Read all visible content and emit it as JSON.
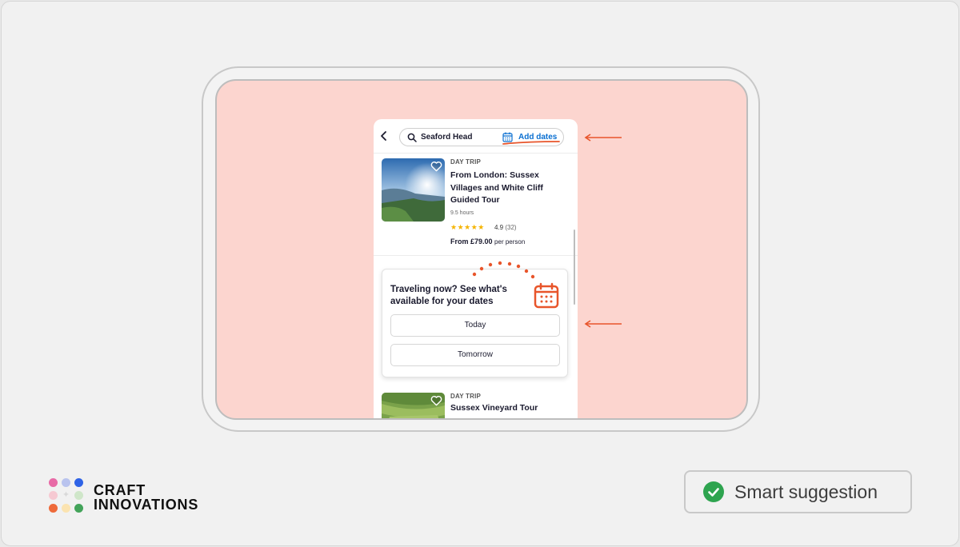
{
  "search": {
    "location": "Seaford Head",
    "add_dates": "Add dates"
  },
  "listing1": {
    "kicker": "DAY TRIP",
    "title": "From London: Sussex Villages and White Cliff Guided Tour",
    "duration": "9.5 hours",
    "stars": "★★★★★",
    "rating": "4.9",
    "reviews": "(32)",
    "price": "From £79.00",
    "price_suffix": "per person"
  },
  "suggestion": {
    "title": "Traveling now? See what's available for your dates",
    "options": [
      "Today",
      "Tomorrow"
    ]
  },
  "listing2": {
    "kicker": "DAY TRIP",
    "title": "Sussex Vineyard Tour"
  },
  "brand": {
    "line1": "CRAFT",
    "line2": "INNOVATIONS"
  },
  "badge": {
    "label": "Smart suggestion"
  },
  "colors": {
    "screen_bg": "#fcd5cf",
    "accent_link": "#0a6fd1",
    "annotation": "#e8552b",
    "badge_check": "#2ea44f",
    "star": "#f5b400"
  },
  "icons": [
    "back-chevron-icon",
    "search-icon",
    "calendar-icon",
    "heart-icon",
    "check-circle-icon",
    "arrow-left-icon"
  ]
}
